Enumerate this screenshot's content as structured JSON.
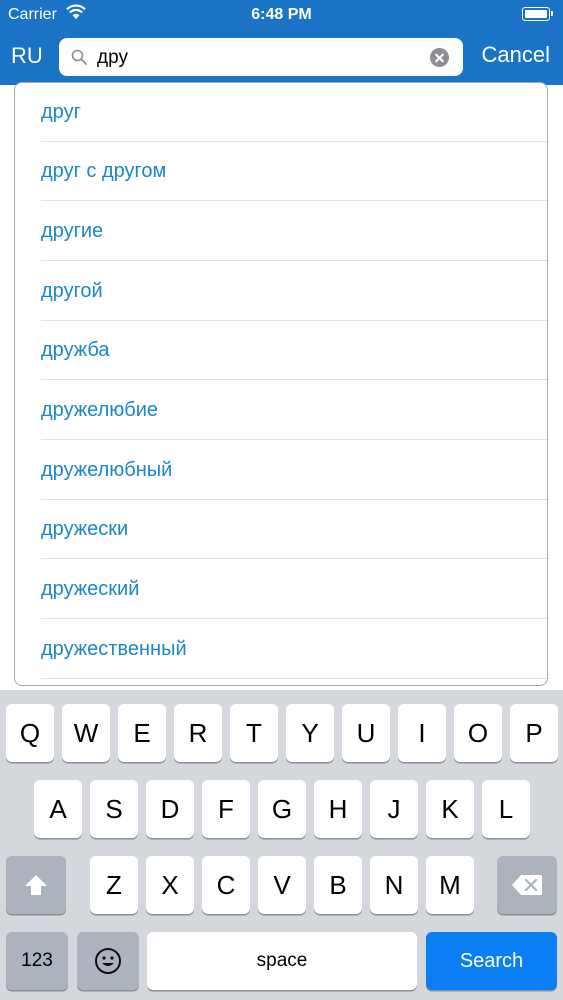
{
  "status_bar": {
    "carrier": "Carrier",
    "time": "6:48 PM"
  },
  "nav": {
    "language": "RU",
    "search_query": "дру",
    "cancel_label": "Cancel"
  },
  "suggestions": [
    "друг",
    "друг с другом",
    "другие",
    "другой",
    "дружба",
    "дружелюбие",
    "дружелюбный",
    "дружески",
    "дружеский",
    "дружественный"
  ],
  "keyboard": {
    "row1": [
      "Q",
      "W",
      "E",
      "R",
      "T",
      "Y",
      "U",
      "I",
      "O",
      "P"
    ],
    "row2": [
      "A",
      "S",
      "D",
      "F",
      "G",
      "H",
      "J",
      "K",
      "L"
    ],
    "row3": [
      "Z",
      "X",
      "C",
      "V",
      "B",
      "N",
      "M"
    ],
    "numbers_label": "123",
    "space_label": "space",
    "search_label": "Search"
  },
  "colors": {
    "nav_background": "#1a73c5",
    "suggestion_text": "#1b86c8",
    "search_key": "#0b7ef4"
  }
}
